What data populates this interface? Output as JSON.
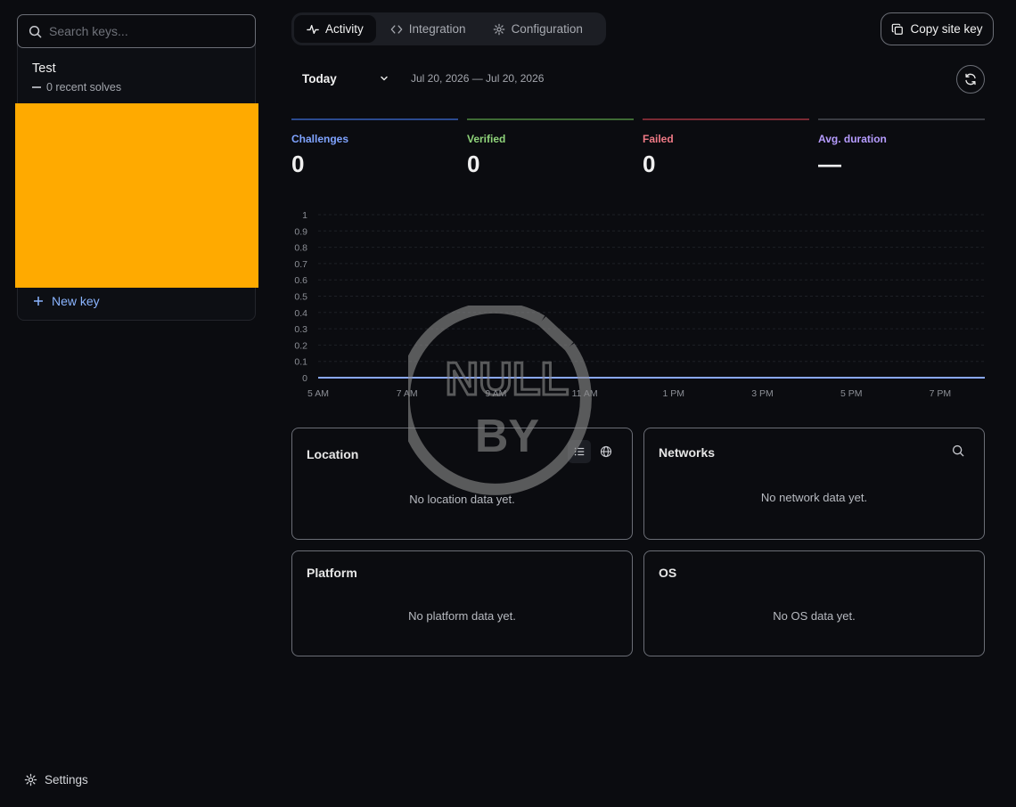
{
  "sidebar": {
    "search_placeholder": "Search keys...",
    "keys": [
      {
        "name": "Test",
        "subtitle": "0 recent solves"
      }
    ],
    "new_key_label": "New key",
    "settings_label": "Settings"
  },
  "header": {
    "tabs": [
      {
        "label": "Activity",
        "icon": "activity-icon",
        "active": true
      },
      {
        "label": "Integration",
        "icon": "code-icon",
        "active": false
      },
      {
        "label": "Configuration",
        "icon": "gear-icon",
        "active": false
      }
    ],
    "copy_site_key_label": "Copy site key"
  },
  "filters": {
    "period": "Today",
    "date_range": "Jul 20, 2026 — Jul 20, 2026"
  },
  "stats": [
    {
      "label": "Challenges",
      "value": "0",
      "color": "#7fa3ff",
      "bar_color": "#2a4a8f"
    },
    {
      "label": "Verified",
      "value": "0",
      "color": "#8fd47a",
      "bar_color": "#3e6a34"
    },
    {
      "label": "Failed",
      "value": "0",
      "color": "#f07a86",
      "bar_color": "#7a2a33"
    },
    {
      "label": "Avg. duration",
      "value": "—",
      "color": "#b69cff",
      "bar_color": "#3a3c42"
    }
  ],
  "chart_data": {
    "type": "line",
    "x": [
      "5 AM",
      "7 AM",
      "9 AM",
      "11 AM",
      "1 PM",
      "3 PM",
      "5 PM",
      "7 PM"
    ],
    "series": [
      {
        "values": [
          0,
          0,
          0,
          0,
          0,
          0,
          0,
          0
        ],
        "color": "#8aa8ff"
      }
    ],
    "y_ticks": [
      "0",
      "0.1",
      "0.2",
      "0.3",
      "0.4",
      "0.5",
      "0.6",
      "0.7",
      "0.8",
      "0.9",
      "1"
    ],
    "ylim": [
      0,
      1
    ],
    "grid": true
  },
  "cards": {
    "location": {
      "title": "Location",
      "empty": "No location data yet."
    },
    "networks": {
      "title": "Networks",
      "empty": "No network data yet."
    },
    "platform": {
      "title": "Platform",
      "empty": "No platform data yet."
    },
    "os": {
      "title": "OS",
      "empty": "No OS data yet."
    }
  },
  "watermark": {
    "line1": "NULL",
    "line2": "BY"
  }
}
